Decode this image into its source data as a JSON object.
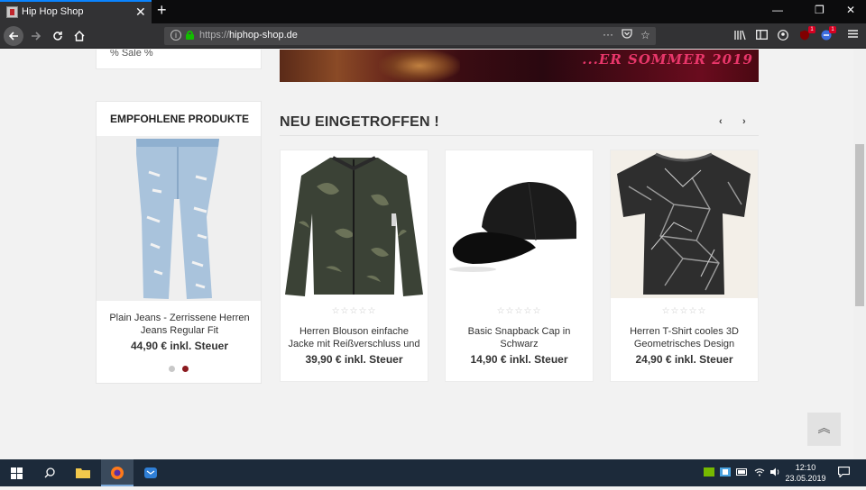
{
  "browser": {
    "tab_title": "Hip Hop Shop",
    "tab_close": "✕",
    "new_tab": "+",
    "url_prefix": "https://",
    "url_domain": "hiphop-shop.de",
    "page_actions": "···",
    "badge_counts": [
      "1",
      "1"
    ]
  },
  "window_controls": {
    "minimize": "—",
    "restore": "❐",
    "close": "✕"
  },
  "page": {
    "sale_text": "% Sale %",
    "banner_text": "...ER SOMMER 2019",
    "featured": {
      "title": "EMPFOHLENE PRODUKTE",
      "product_name": "Plain Jeans - Zerrissene Herren Jeans Regular Fit",
      "product_price": "44,90 € inkl. Steuer"
    },
    "section_title": "NEU EINGETROFFEN !",
    "prev_arrow": "‹",
    "next_arrow": "›",
    "products": [
      {
        "name": "Herren Blouson einfache Jacke mit Reißverschluss und",
        "price": "39,90 € inkl. Steuer",
        "rating": "☆☆☆☆☆"
      },
      {
        "name": "Basic Snapback Cap in Schwarz",
        "price": "14,90 € inkl. Steuer",
        "rating": "☆☆☆☆☆"
      },
      {
        "name": "Herren T-Shirt cooles 3D Geometrisches Design",
        "price": "24,90 € inkl. Steuer",
        "rating": "☆☆☆☆☆"
      }
    ],
    "back_to_top": "︽"
  },
  "taskbar": {
    "time": "12:10",
    "date": "23.05.2019"
  },
  "colors": {
    "accent_red": "#8b1a1f",
    "dot_inactive": "#c8c8c8",
    "firefox_blue": "#0a84ff"
  }
}
